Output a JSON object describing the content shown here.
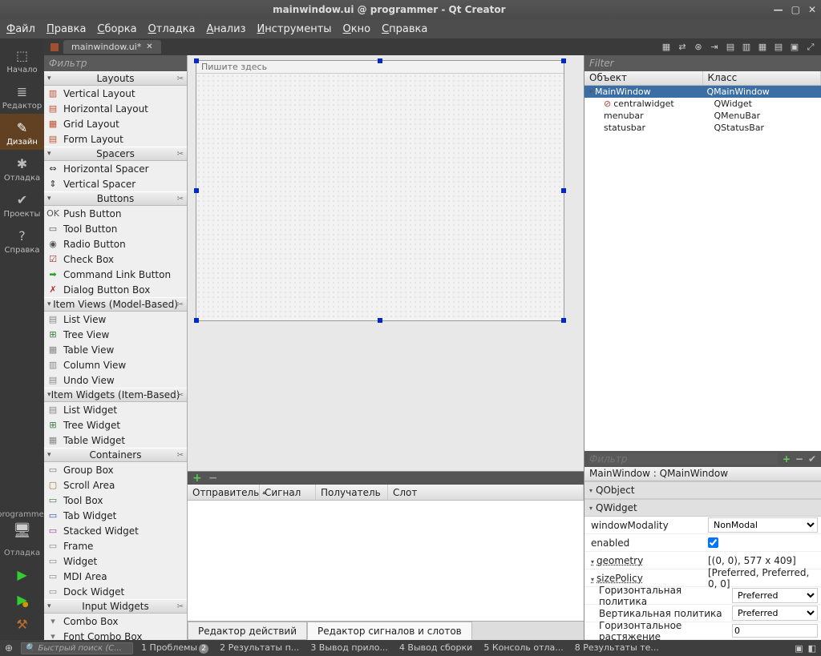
{
  "window": {
    "title": "mainwindow.ui @ programmer - Qt Creator"
  },
  "menubar": [
    "Файл",
    "Правка",
    "Сборка",
    "Отладка",
    "Анализ",
    "Инструменты",
    "Окно",
    "Справка"
  ],
  "tabs": {
    "open_file": "mainwindow.ui*"
  },
  "activity": {
    "items": [
      {
        "label": "Начало",
        "icon": "⬚"
      },
      {
        "label": "Редактор",
        "icon": "≣"
      },
      {
        "label": "Дизайн",
        "icon": "✎",
        "selected": true
      },
      {
        "label": "Отладка",
        "icon": "✱"
      },
      {
        "label": "Проекты",
        "icon": "✔"
      },
      {
        "label": "Справка",
        "icon": "?"
      }
    ],
    "project": "programmer",
    "debug_label": "Отладка"
  },
  "widgetbox": {
    "filter_placeholder": "Фильтр",
    "categories": [
      {
        "name": "Layouts",
        "items": [
          {
            "label": "Vertical Layout",
            "icon": "▥",
            "color": "#c05030"
          },
          {
            "label": "Horizontal Layout",
            "icon": "▤",
            "color": "#c05030"
          },
          {
            "label": "Grid Layout",
            "icon": "▦",
            "color": "#c05030"
          },
          {
            "label": "Form Layout",
            "icon": "▤",
            "color": "#c05030"
          }
        ]
      },
      {
        "name": "Spacers",
        "items": [
          {
            "label": "Horizontal Spacer",
            "icon": "⇔",
            "color": "#303030"
          },
          {
            "label": "Vertical Spacer",
            "icon": "⇕",
            "color": "#303030"
          }
        ]
      },
      {
        "name": "Buttons",
        "items": [
          {
            "label": "Push Button",
            "icon": "OK",
            "color": "#555"
          },
          {
            "label": "Tool Button",
            "icon": "▭",
            "color": "#555"
          },
          {
            "label": "Radio Button",
            "icon": "◉",
            "color": "#555"
          },
          {
            "label": "Check Box",
            "icon": "☑",
            "color": "#b03030"
          },
          {
            "label": "Command Link Button",
            "icon": "➡",
            "color": "#2a9d2a"
          },
          {
            "label": "Dialog Button Box",
            "icon": "✗",
            "color": "#b03030"
          }
        ]
      },
      {
        "name": "Item Views (Model-Based)",
        "items": [
          {
            "label": "List View",
            "icon": "▤",
            "color": "#888"
          },
          {
            "label": "Tree View",
            "icon": "⊞",
            "color": "#3a7a3a"
          },
          {
            "label": "Table View",
            "icon": "▦",
            "color": "#888"
          },
          {
            "label": "Column View",
            "icon": "▥",
            "color": "#888"
          },
          {
            "label": "Undo View",
            "icon": "▤",
            "color": "#888"
          }
        ]
      },
      {
        "name": "Item Widgets (Item-Based)",
        "items": [
          {
            "label": "List Widget",
            "icon": "▤",
            "color": "#888"
          },
          {
            "label": "Tree Widget",
            "icon": "⊞",
            "color": "#3a7a3a"
          },
          {
            "label": "Table Widget",
            "icon": "▦",
            "color": "#888"
          }
        ]
      },
      {
        "name": "Containers",
        "items": [
          {
            "label": "Group Box",
            "icon": "▭",
            "color": "#777"
          },
          {
            "label": "Scroll Area",
            "icon": "▢",
            "color": "#a07030"
          },
          {
            "label": "Tool Box",
            "icon": "▭",
            "color": "#3a7a3a"
          },
          {
            "label": "Tab Widget",
            "icon": "▭",
            "color": "#3050a0"
          },
          {
            "label": "Stacked Widget",
            "icon": "▭",
            "color": "#a04090"
          },
          {
            "label": "Frame",
            "icon": "▭",
            "color": "#888"
          },
          {
            "label": "Widget",
            "icon": "▭",
            "color": "#888"
          },
          {
            "label": "MDI Area",
            "icon": "▭",
            "color": "#888"
          },
          {
            "label": "Dock Widget",
            "icon": "▭",
            "color": "#888"
          }
        ]
      },
      {
        "name": "Input Widgets",
        "items": [
          {
            "label": "Combo Box",
            "icon": "▾",
            "color": "#777"
          },
          {
            "label": "Font Combo Box",
            "icon": "▾",
            "color": "#777"
          }
        ]
      }
    ]
  },
  "canvas": {
    "menubar_hint": "Пишите здесь"
  },
  "signals": {
    "columns": [
      "Отправитель",
      "Сигнал",
      "Получатель",
      "Слот"
    ],
    "tabs": [
      "Редактор действий",
      "Редактор сигналов и слотов"
    ],
    "active_tab": 1
  },
  "objecttree": {
    "filter_placeholder": "Filter",
    "columns": [
      "Объект",
      "Класс"
    ],
    "rows": [
      {
        "name": "MainWindow",
        "class": "QMainWindow",
        "depth": 0,
        "selected": true,
        "caret": "▾"
      },
      {
        "name": "centralwidget",
        "class": "QWidget",
        "depth": 1,
        "icon": "⊘"
      },
      {
        "name": "menubar",
        "class": "QMenuBar",
        "depth": 1
      },
      {
        "name": "statusbar",
        "class": "QStatusBar",
        "depth": 1
      }
    ]
  },
  "props": {
    "filter_placeholder": "Фильтр",
    "crumb": "MainWindow : QMainWindow",
    "groups": [
      {
        "name": "QObject",
        "rows": []
      },
      {
        "name": "QWidget",
        "rows": [
          {
            "key": "windowModality",
            "value": "NonModal",
            "type": "select"
          },
          {
            "key": "enabled",
            "value": true,
            "type": "check"
          },
          {
            "key": "geometry",
            "value": "[(0, 0), 577 x 409]",
            "type": "expand",
            "underline": true
          },
          {
            "key": "sizePolicy",
            "value": "[Preferred, Preferred, 0, 0]",
            "type": "expand",
            "underline": true,
            "children": [
              {
                "key": "Горизонтальная политика",
                "value": "Preferred",
                "type": "select"
              },
              {
                "key": "Вертикальная политика",
                "value": "Preferred",
                "type": "select"
              },
              {
                "key": "Горизонтальное растяжение",
                "value": "0",
                "type": "text"
              }
            ]
          }
        ]
      }
    ]
  },
  "statusbar": {
    "search_placeholder": "Быстрый поиск (C...",
    "items": [
      {
        "n": "1",
        "label": "Проблемы",
        "badge": "2"
      },
      {
        "n": "2",
        "label": "Результаты п..."
      },
      {
        "n": "3",
        "label": "Вывод прило..."
      },
      {
        "n": "4",
        "label": "Вывод сборки"
      },
      {
        "n": "5",
        "label": "Консоль отла..."
      },
      {
        "n": "8",
        "label": "Результаты те..."
      }
    ]
  }
}
